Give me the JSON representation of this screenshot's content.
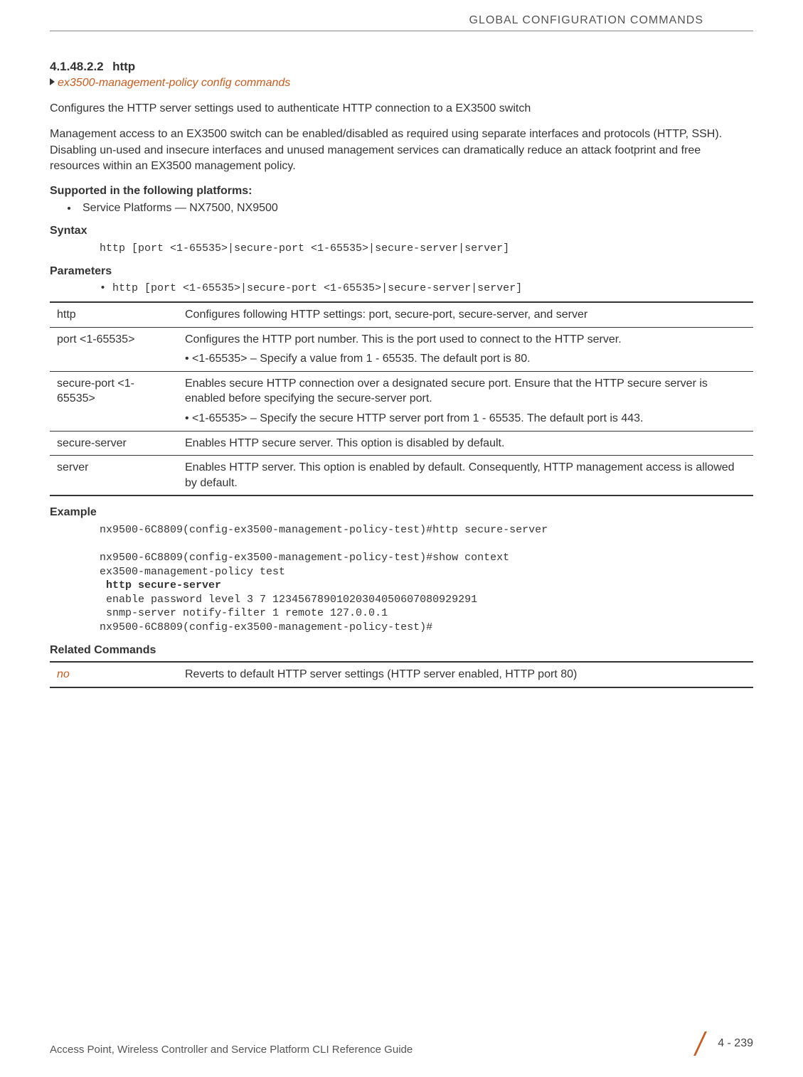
{
  "header": {
    "running_head": "GLOBAL CONFIGURATION COMMANDS"
  },
  "section": {
    "number": "4.1.48.2.2",
    "title": "http",
    "xref": "ex3500-management-policy config commands"
  },
  "body": {
    "intro": "Configures the HTTP server settings used to authenticate HTTP connection to a EX3500 switch",
    "desc": "Management access to an EX3500 switch can be enabled/disabled as required using separate interfaces and protocols (HTTP, SSH). Disabling un-used and insecure interfaces and unused management services can dramatically reduce an attack footprint and free resources within an EX3500 management policy."
  },
  "platforms": {
    "heading": "Supported in the following platforms:",
    "item": "Service Platforms — NX7500, NX9500"
  },
  "syntax": {
    "heading": "Syntax",
    "text": "http [port <1-65535>|secure-port <1-65535>|secure-server|server]"
  },
  "parameters": {
    "heading": "Parameters",
    "bullet": "• http [port <1-65535>|secure-port <1-65535>|secure-server|server]",
    "rows": [
      {
        "key": "http",
        "desc": "Configures following HTTP settings: port, secure-port, secure-server, and server"
      },
      {
        "key": "port <1-65535>",
        "desc": "Configures the HTTP port number. This is the port used to connect to the HTTP server.",
        "sub": "<1-65535> – Specify a value from 1 - 65535. The default port is 80."
      },
      {
        "key": "secure-port <1-65535>",
        "desc": "Enables secure HTTP connection over a designated secure port. Ensure that the HTTP secure server is enabled before specifying the secure-server port.",
        "sub": "<1-65535> – Specify the secure HTTP server port from 1 - 65535. The default port is 443."
      },
      {
        "key": "secure-server",
        "desc": "Enables HTTP secure server. This option is disabled by default."
      },
      {
        "key": "server",
        "desc": "Enables HTTP server. This option is enabled by default. Consequently, HTTP management access is allowed by default."
      }
    ]
  },
  "example": {
    "heading": "Example",
    "line1": "nx9500-6C8809(config-ex3500-management-policy-test)#http secure-server",
    "line2": "nx9500-6C8809(config-ex3500-management-policy-test)#show context",
    "line3": "ex3500-management-policy test",
    "line4": " http secure-server",
    "line5": " enable password level 3 7 12345678901020304050607080929291",
    "line6": " snmp-server notify-filter 1 remote 127.0.0.1",
    "line7": "nx9500-6C8809(config-ex3500-management-policy-test)#"
  },
  "related": {
    "heading": "Related Commands",
    "cmd": "no",
    "desc": "Reverts to default HTTP server settings (HTTP server enabled, HTTP port 80)"
  },
  "footer": {
    "left": "Access Point, Wireless Controller and Service Platform CLI Reference Guide",
    "page": "4 - 239"
  }
}
